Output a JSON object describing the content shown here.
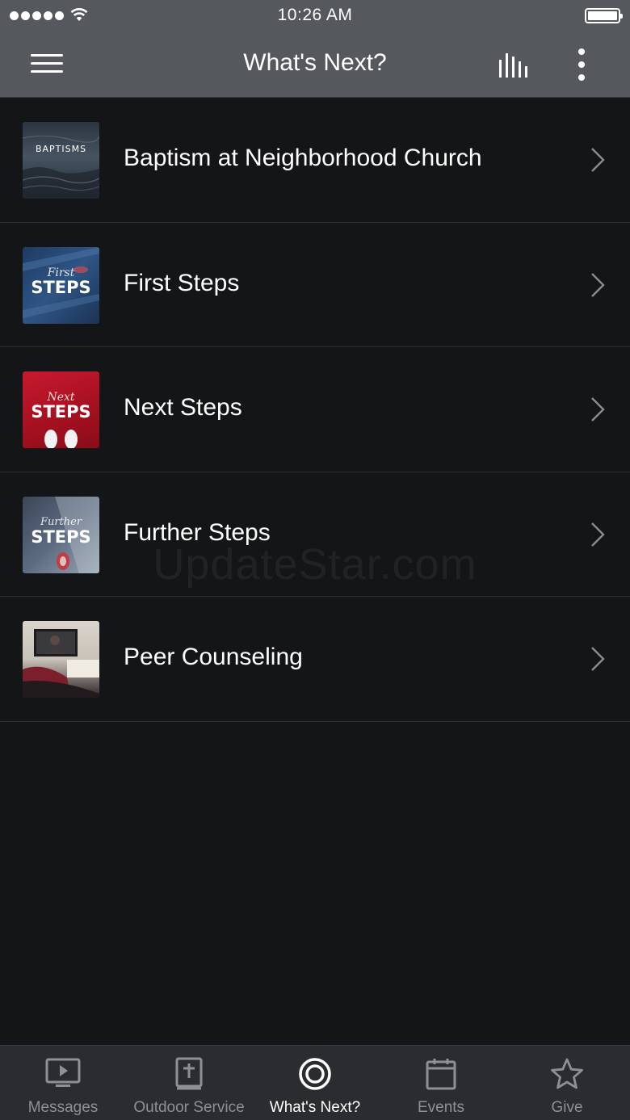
{
  "status_bar": {
    "time": "10:26 AM"
  },
  "header": {
    "title": "What's Next?"
  },
  "list": {
    "items": [
      {
        "title": "Baptism at Neighborhood Church",
        "thumb_text": "BAPTISMS",
        "thumb_script": ""
      },
      {
        "title": "First Steps",
        "thumb_text": "STEPS",
        "thumb_script": "First"
      },
      {
        "title": "Next Steps",
        "thumb_text": "STEPS",
        "thumb_script": "Next"
      },
      {
        "title": "Further Steps",
        "thumb_text": "STEPS",
        "thumb_script": "Further"
      },
      {
        "title": "Peer Counseling",
        "thumb_text": "",
        "thumb_script": ""
      }
    ]
  },
  "watermark": "UpdateStar.com",
  "tabs": [
    {
      "label": "Messages",
      "icon": "screen-play-icon",
      "active": false
    },
    {
      "label": "Outdoor Service",
      "icon": "bible-icon",
      "active": false
    },
    {
      "label": "What's Next?",
      "icon": "target-icon",
      "active": true
    },
    {
      "label": "Events",
      "icon": "calendar-icon",
      "active": false
    },
    {
      "label": "Give",
      "icon": "star-icon",
      "active": false
    }
  ],
  "colors": {
    "header_bg": "#55585c",
    "page_bg": "#141517",
    "tabbar_bg": "#2a2c2f",
    "tab_inactive": "#8d9095",
    "tab_active": "#ffffff"
  }
}
